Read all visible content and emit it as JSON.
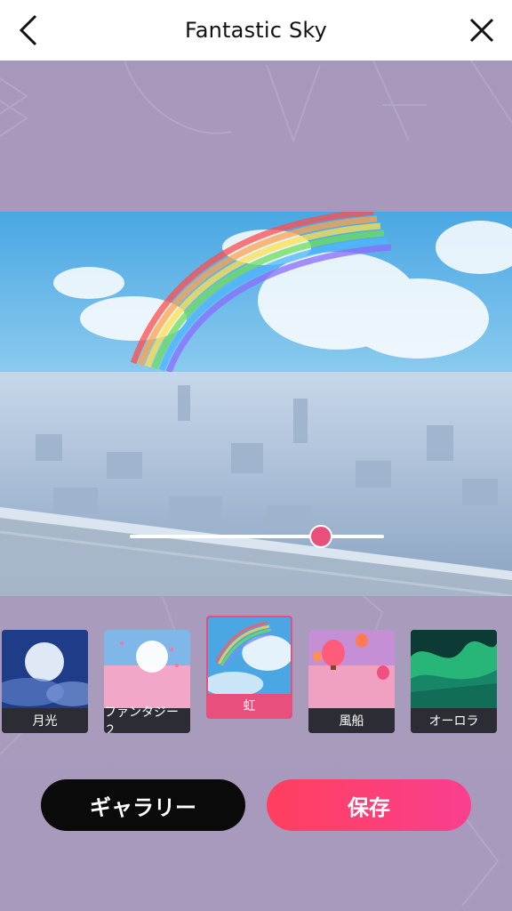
{
  "header": {
    "title": "Fantastic Sky",
    "back_icon": "chevron-left-icon",
    "close_icon": "close-icon"
  },
  "slider": {
    "value": 0.75
  },
  "filters": [
    {
      "label": "月光",
      "selected": false
    },
    {
      "label": "ファンタジー２",
      "selected": false
    },
    {
      "label": "虹",
      "selected": true
    },
    {
      "label": "風船",
      "selected": false
    },
    {
      "label": "オーロラ",
      "selected": false
    }
  ],
  "buttons": {
    "gallery": "ギャラリー",
    "save": "保存"
  },
  "colors": {
    "accent": "#e94f7c",
    "background": "#a99bbd",
    "save_gradient_start": "#ff3f5e",
    "save_gradient_end": "#f93f8f"
  }
}
